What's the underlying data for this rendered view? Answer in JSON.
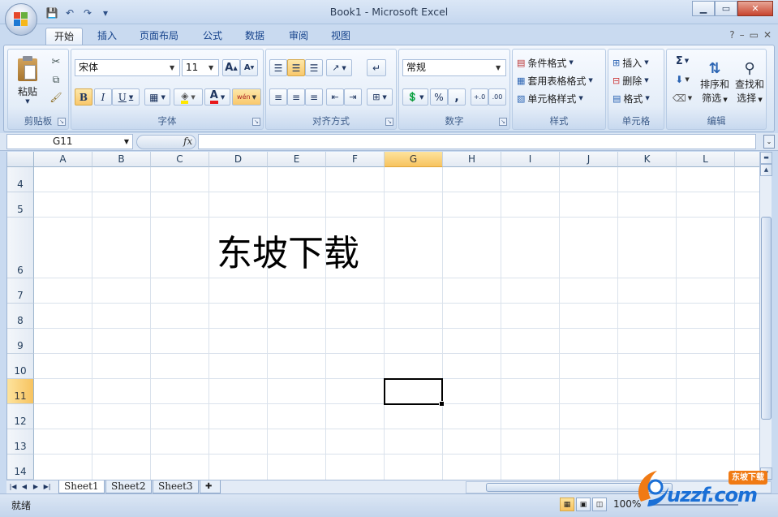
{
  "window": {
    "title": "Book1 - Microsoft Excel"
  },
  "qat": {
    "save": "💾",
    "undo": "↶",
    "redo": "↷",
    "customize": "▾"
  },
  "window_controls": {
    "minimize": "▁",
    "maximize": "▭",
    "close": "✕"
  },
  "tabs": [
    {
      "label": "开始",
      "active": true
    },
    {
      "label": "插入",
      "active": false
    },
    {
      "label": "页面布局",
      "active": false
    },
    {
      "label": "公式",
      "active": false
    },
    {
      "label": "数据",
      "active": false
    },
    {
      "label": "审阅",
      "active": false
    },
    {
      "label": "视图",
      "active": false
    }
  ],
  "ribbon": {
    "clipboard": {
      "title": "剪贴板",
      "paste": "粘贴"
    },
    "font": {
      "title": "字体",
      "font_name": "宋体",
      "font_size": "11",
      "bold": "B",
      "italic": "I",
      "underline": "U",
      "grow": "A",
      "shrink": "A",
      "font_color_letter": "A",
      "phonetic": "wén"
    },
    "alignment": {
      "title": "对齐方式"
    },
    "number": {
      "title": "数字",
      "format": "常规",
      "percent": "%",
      "comma": ",",
      "inc_decimal": "+.0",
      "dec_decimal": ".00"
    },
    "styles": {
      "title": "样式",
      "conditional": "条件格式",
      "table_format": "套用表格格式",
      "cell_styles": "单元格样式"
    },
    "cells": {
      "title": "单元格",
      "insert": "插入",
      "delete": "删除",
      "format": "格式"
    },
    "editing": {
      "title": "编辑",
      "sum": "Σ",
      "sort_line1": "排序和",
      "sort_line2": "筛选",
      "find_line1": "查找和",
      "find_line2": "选择"
    }
  },
  "formula_bar": {
    "name_box": "G11",
    "fx": "fx",
    "content": ""
  },
  "columns": [
    "A",
    "B",
    "C",
    "D",
    "E",
    "F",
    "G",
    "H",
    "I",
    "J",
    "K",
    "L"
  ],
  "rows": [
    "4",
    "5",
    "6",
    "7",
    "8",
    "9",
    "10",
    "11",
    "12",
    "13",
    "14"
  ],
  "selected": {
    "column": "G",
    "row": "11"
  },
  "cell_content": {
    "ref": "D6",
    "text": "东坡下载"
  },
  "sheets": [
    {
      "name": "Sheet1",
      "active": true
    },
    {
      "name": "Sheet2",
      "active": false
    },
    {
      "name": "Sheet3",
      "active": false
    }
  ],
  "status": {
    "text": "就绪",
    "zoom": "100%"
  },
  "watermark": {
    "text": "uzzf.com",
    "badge": "东坡下载"
  },
  "colors": {
    "accent": "#15428b",
    "selected_header": "#f7c35f",
    "grid": "#dae2ec"
  }
}
